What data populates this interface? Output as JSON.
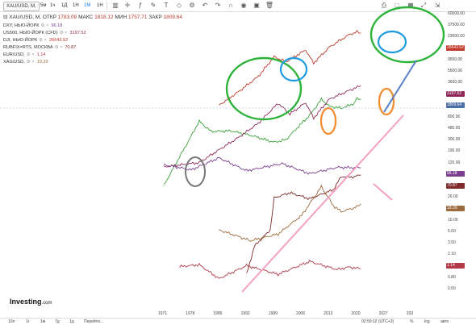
{
  "toolbar": {
    "symbol": "XAU/USD, M,",
    "intervals": [
      "5м",
      "1ч",
      "1Д",
      "1Н",
      "1М",
      "1Н"
    ],
    "active_interval": 4
  },
  "ohlc": {
    "open_label": "ОТКР",
    "open": "1783.09",
    "high_label": "МАКС",
    "high": "1818.12",
    "low_label": "МИН",
    "low": "1757.71",
    "close_label": "ЗАКР",
    "close": "1809.64"
  },
  "legend": [
    {
      "name": "DXY, НЬЮ-ЙОРК",
      "value": "96.18",
      "color": "#7a3f8f"
    },
    {
      "name": "US500, НЬЮ-ЙОРК (CFD)",
      "value": "3197.52",
      "color": "#8e2a5a"
    },
    {
      "name": "DJI, НЬЮ-ЙОРК",
      "value": "26643.52",
      "color": "#c0392b"
    },
    {
      "name": "RUBFIX=RTS, МОСКВА",
      "value": "70.87",
      "color": "#7d2b2b"
    },
    {
      "name": "EUR/USD,",
      "value": "1.14",
      "color": "#b23a48"
    },
    {
      "name": "XAG/USD,",
      "value": "19.29",
      "color": "#9c6a3c"
    }
  ],
  "y_axis_ticks": [
    "60000.00",
    "37500.00",
    "23000.00",
    "14500.00",
    "9500.00",
    "5500.00",
    "3600.00",
    "2400.00",
    "1300.00",
    "800.00",
    "480.00",
    "300.00",
    "190.00",
    "120.00",
    "74.00",
    "42.00",
    "26.00",
    "16.00",
    "10.00",
    "5.60",
    "3.50",
    "2.10",
    "1.30",
    "0.80",
    "0.50"
  ],
  "y_badges": [
    {
      "text": "26643.52",
      "color": "#c0392b",
      "row": 3
    },
    {
      "text": "3197.52",
      "color": "#8e2a5a",
      "row": 7
    },
    {
      "text": "1809.64",
      "color": "#4a6fa5",
      "row": 8
    },
    {
      "text": "96.18",
      "color": "#7a3f8f",
      "row": 14
    },
    {
      "text": "70.87",
      "color": "#7d2b2b",
      "row": 15
    },
    {
      "text": "19.29",
      "color": "#9c6a3c",
      "row": 17
    },
    {
      "text": "1.14",
      "color": "#b23a48",
      "row": 22
    }
  ],
  "x_axis_ticks": [
    "1971",
    "1978",
    "1985",
    "1992",
    "1999",
    "2006",
    "2013",
    "2020",
    "2027",
    "203"
  ],
  "logo": {
    "main": "Investing",
    "suffix": ".com"
  },
  "bottom": {
    "ranges": [
      "10л",
      "1г",
      "1м",
      "7д",
      "1д",
      "Перейти..."
    ],
    "time": "02:59:12 (UTC+3)",
    "scale_pct": "%",
    "scale_log": "log",
    "scale_auto": "авто"
  },
  "chart_data": {
    "type": "line",
    "x_range": [
      1965,
      2033
    ],
    "series": [
      {
        "name": "XAU/USD,",
        "color": "#3aa03a",
        "points": [
          [
            1971,
            42
          ],
          [
            1975,
            150
          ],
          [
            1980,
            650
          ],
          [
            1983,
            420
          ],
          [
            1988,
            430
          ],
          [
            1993,
            360
          ],
          [
            1999,
            270
          ],
          [
            2002,
            300
          ],
          [
            2006,
            600
          ],
          [
            2008,
            850
          ],
          [
            2011,
            1800
          ],
          [
            2013,
            1250
          ],
          [
            2016,
            1150
          ],
          [
            2019,
            1400
          ],
          [
            2020,
            1800
          ],
          [
            2021,
            1809.64
          ]
        ]
      },
      {
        "name": "DJI, НЬЮ-ЙОРК",
        "color": "#c0392b",
        "points": [
          [
            1985,
            1300
          ],
          [
            1990,
            2600
          ],
          [
            1995,
            4500
          ],
          [
            1999,
            10500
          ],
          [
            2002,
            8500
          ],
          [
            2007,
            13500
          ],
          [
            2009,
            8000
          ],
          [
            2013,
            15000
          ],
          [
            2018,
            25000
          ],
          [
            2020,
            28000
          ],
          [
            2021,
            26643.52
          ]
        ]
      },
      {
        "name": "US500, НЬЮ-ЙОРК (CFD)",
        "color": "#8e2a5a",
        "points": [
          [
            1971,
            100
          ],
          [
            1980,
            120
          ],
          [
            1985,
            200
          ],
          [
            1990,
            330
          ],
          [
            1995,
            600
          ],
          [
            2000,
            1450
          ],
          [
            2003,
            900
          ],
          [
            2007,
            1500
          ],
          [
            2009,
            750
          ],
          [
            2013,
            1800
          ],
          [
            2018,
            2700
          ],
          [
            2021,
            3197.52
          ]
        ]
      },
      {
        "name": "DXY, НЬЮ-ЙОРК",
        "color": "#7a3f8f",
        "points": [
          [
            1971,
            110
          ],
          [
            1978,
            88
          ],
          [
            1985,
            145
          ],
          [
            1992,
            85
          ],
          [
            2001,
            115
          ],
          [
            2008,
            75
          ],
          [
            2015,
            98
          ],
          [
            2021,
            96.18
          ]
        ]
      },
      {
        "name": "RUBFIX=RTS, МОСКВА",
        "color": "#7d2b2b",
        "points": [
          [
            1992,
            0.9
          ],
          [
            1994,
            3
          ],
          [
            1998,
            6
          ],
          [
            1999,
            25
          ],
          [
            2003,
            31
          ],
          [
            2008,
            24
          ],
          [
            2014,
            35
          ],
          [
            2016,
            65
          ],
          [
            2019,
            64
          ],
          [
            2021,
            70.87
          ]
        ]
      },
      {
        "name": "XAG/USD,",
        "color": "#9c6a3c",
        "points": [
          [
            1985,
            6
          ],
          [
            1990,
            4.5
          ],
          [
            1993,
            3.8
          ],
          [
            2000,
            5
          ],
          [
            2006,
            12
          ],
          [
            2011,
            40
          ],
          [
            2014,
            18
          ],
          [
            2016,
            14
          ],
          [
            2020,
            17
          ],
          [
            2021,
            19.29
          ]
        ]
      },
      {
        "name": "EUR/USD,",
        "color": "#b23a48",
        "points": [
          [
            1975,
            1.25
          ],
          [
            1980,
            1.35
          ],
          [
            1985,
            0.75
          ],
          [
            1992,
            1.3
          ],
          [
            2000,
            0.9
          ],
          [
            2008,
            1.55
          ],
          [
            2015,
            1.1
          ],
          [
            2018,
            1.22
          ],
          [
            2021,
            1.14
          ]
        ]
      }
    ]
  }
}
